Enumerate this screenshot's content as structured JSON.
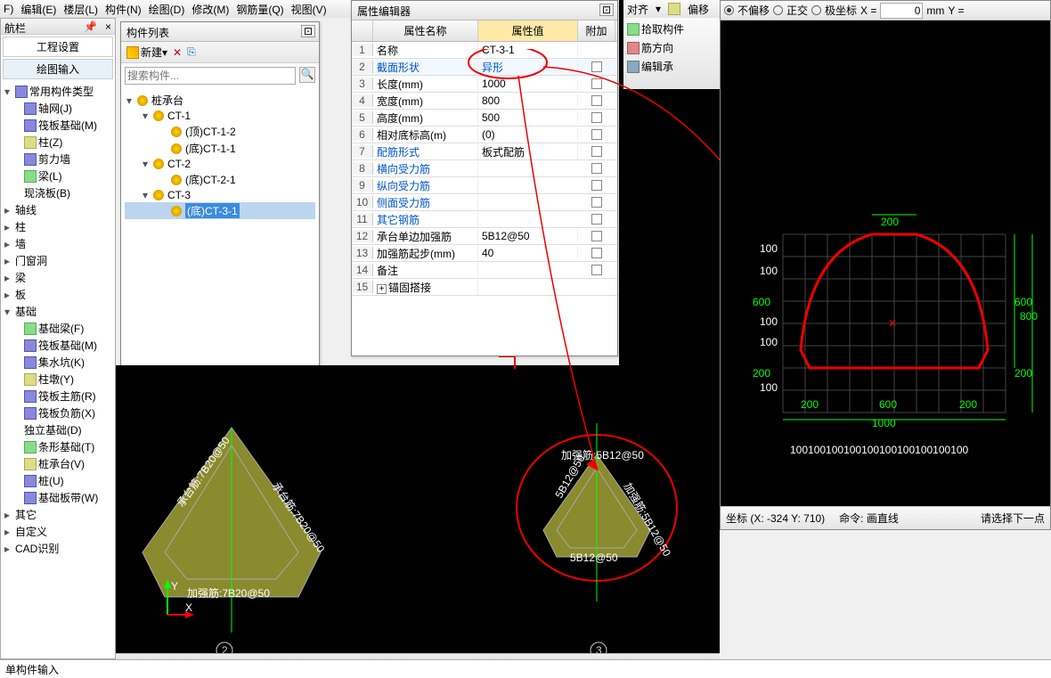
{
  "menu": {
    "items": [
      "F)",
      "编辑(E)",
      "楼层(L)",
      "构件(N)",
      "绘图(D)",
      "修改(M)",
      "钢筋量(Q)",
      "视图(V)"
    ]
  },
  "nav": {
    "title": "航栏",
    "tabs": {
      "proj": "工程设置",
      "draw": "绘图输入"
    },
    "items": [
      {
        "label": "常用构件类型",
        "ico": "b1",
        "toggle": "▾"
      },
      {
        "label": "轴网(J)",
        "ico": "b1",
        "sub": true
      },
      {
        "label": "筏板基础(M)",
        "ico": "b1",
        "sub": true
      },
      {
        "label": "柱(Z)",
        "ico": "b3",
        "sub": true
      },
      {
        "label": "剪力墙",
        "ico": "b1",
        "sub": true
      },
      {
        "label": "梁(L)",
        "ico": "b2",
        "sub": true
      },
      {
        "label": "现浇板(B)",
        "ico": "",
        "sub": true
      },
      {
        "label": "轴线",
        "ico": "",
        "toggle": "▸"
      },
      {
        "label": "柱",
        "ico": "",
        "toggle": "▸"
      },
      {
        "label": "墙",
        "ico": "",
        "toggle": "▸"
      },
      {
        "label": "门窗洞",
        "ico": "",
        "toggle": "▸"
      },
      {
        "label": "梁",
        "ico": "",
        "toggle": "▸"
      },
      {
        "label": "板",
        "ico": "",
        "toggle": "▸"
      },
      {
        "label": "基础",
        "ico": "",
        "toggle": "▾"
      },
      {
        "label": "基础梁(F)",
        "ico": "b2",
        "sub": true
      },
      {
        "label": "筏板基础(M)",
        "ico": "b1",
        "sub": true
      },
      {
        "label": "集水坑(K)",
        "ico": "b1",
        "sub": true
      },
      {
        "label": "柱墩(Y)",
        "ico": "b3",
        "sub": true
      },
      {
        "label": "筏板主筋(R)",
        "ico": "b1",
        "sub": true
      },
      {
        "label": "筏板负筋(X)",
        "ico": "b1",
        "sub": true
      },
      {
        "label": "独立基础(D)",
        "ico": "",
        "sub": true
      },
      {
        "label": "条形基础(T)",
        "ico": "b2",
        "sub": true
      },
      {
        "label": "桩承台(V)",
        "ico": "b3",
        "sub": true
      },
      {
        "label": "桩(U)",
        "ico": "b1",
        "sub": true
      },
      {
        "label": "基础板带(W)",
        "ico": "b1",
        "sub": true
      },
      {
        "label": "其它",
        "ico": "",
        "toggle": "▸"
      },
      {
        "label": "自定义",
        "ico": "",
        "toggle": "▸"
      },
      {
        "label": "CAD识别",
        "ico": "",
        "toggle": "▸"
      }
    ]
  },
  "comp": {
    "title": "构件列表",
    "new_btn": "新建",
    "search_ph": "搜索构件...",
    "tree": [
      {
        "label": "桩承台",
        "ind": 0,
        "toggle": "▾"
      },
      {
        "label": "CT-1",
        "ind": 1,
        "toggle": "▾"
      },
      {
        "label": "(顶)CT-1-2",
        "ind": 2
      },
      {
        "label": "(底)CT-1-1",
        "ind": 2
      },
      {
        "label": "CT-2",
        "ind": 1,
        "toggle": "▾"
      },
      {
        "label": "(底)CT-2-1",
        "ind": 2
      },
      {
        "label": "CT-3",
        "ind": 1,
        "toggle": "▾"
      },
      {
        "label": "(底)CT-3-1",
        "ind": 2,
        "sel": true
      }
    ]
  },
  "prop": {
    "title": "属性编辑器",
    "headers": {
      "name": "属性名称",
      "value": "属性值",
      "add": "附加"
    },
    "rows": [
      {
        "n": "1",
        "name": "名称",
        "val": "CT-3-1",
        "lnk": false
      },
      {
        "n": "2",
        "name": "截面形状",
        "val": "异形",
        "lnk": true,
        "sel": true
      },
      {
        "n": "3",
        "name": "长度(mm)",
        "val": "1000",
        "lnk": false
      },
      {
        "n": "4",
        "name": "宽度(mm)",
        "val": "800",
        "lnk": false
      },
      {
        "n": "5",
        "name": "高度(mm)",
        "val": "500",
        "lnk": false
      },
      {
        "n": "6",
        "name": "相对底标高(m)",
        "val": "(0)",
        "lnk": false
      },
      {
        "n": "7",
        "name": "配筋形式",
        "val": "板式配筋",
        "lnk": true
      },
      {
        "n": "8",
        "name": "横向受力筋",
        "val": "",
        "lnk": true
      },
      {
        "n": "9",
        "name": "纵向受力筋",
        "val": "",
        "lnk": true
      },
      {
        "n": "10",
        "name": "侧面受力筋",
        "val": "",
        "lnk": true
      },
      {
        "n": "11",
        "name": "其它钢筋",
        "val": "",
        "lnk": true
      },
      {
        "n": "12",
        "name": "承台单边加强筋",
        "val": "5B12@50",
        "lnk": false
      },
      {
        "n": "13",
        "name": "加强筋起步(mm)",
        "val": "40",
        "lnk": false
      },
      {
        "n": "14",
        "name": "备注",
        "val": "",
        "lnk": false
      },
      {
        "n": "15",
        "name": "锚固搭接",
        "val": "",
        "lnk": false,
        "plus": true
      }
    ]
  },
  "tb": {
    "align": "对齐",
    "offset": "偏移",
    "pick": "拾取构件",
    "dir": "筋方向",
    "edit": "编辑承"
  },
  "cross": {
    "radios": {
      "keep": "不偏移",
      "ortho": "正交",
      "polar": "极坐标"
    },
    "x_lbl": "X =",
    "x_val": "0",
    "mm": "mm",
    "y_lbl": "Y =",
    "dims": {
      "top": "200",
      "h1": "600",
      "h2": "800",
      "b200": "200",
      "b600": "600",
      "bot": "1000",
      "tick": "100"
    },
    "grid_labels": "100100100100100100100100100100",
    "vgrid": [
      "100",
      "100",
      "100",
      "600",
      "100",
      "100",
      "200",
      "100"
    ],
    "status": {
      "coord": "坐标 (X: -324 Y: 710)",
      "cmd": "命令: 画直线",
      "prompt": "请选择下一点"
    }
  },
  "main_canvas": {
    "left_shape": {
      "a": "承台筋:7B20@50",
      "b": "加强筋:7B20@50",
      "c": "承台筋:7B20@50"
    },
    "right_shape": {
      "a": "加强筋:5B12@50",
      "b": "5B12@50",
      "c": "加强筋:5B12@50",
      "d": "5B12@50"
    },
    "axis_x": "X",
    "axis_y": "Y",
    "axis_2": "2",
    "axis_3": "3"
  },
  "footer": {
    "label": "单构件输入"
  }
}
